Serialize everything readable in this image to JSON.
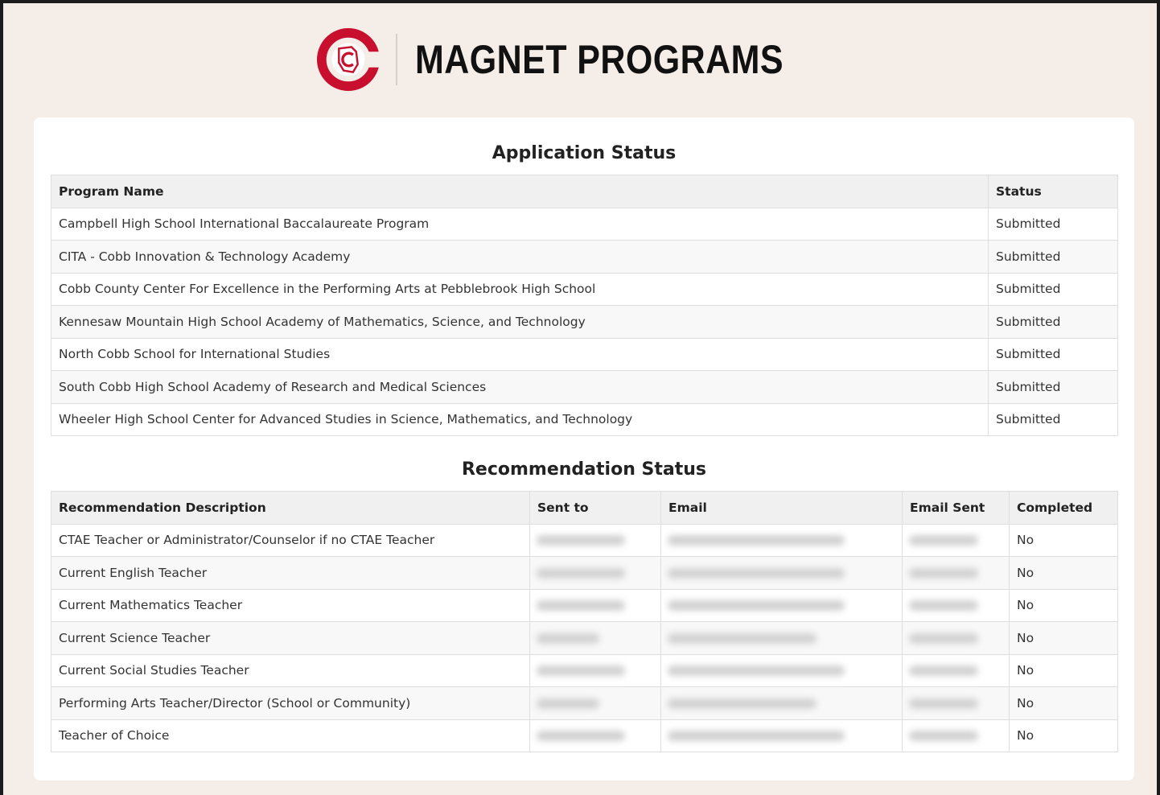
{
  "brand": {
    "title": "MAGNET PROGRAMS",
    "logo_icon": "cobb-county-c-logo-icon",
    "colors": {
      "logo_red": "#c8102e",
      "page_bg": "#f5eee8"
    }
  },
  "application": {
    "title": "Application Status",
    "headers": {
      "program": "Program Name",
      "status": "Status"
    },
    "rows": [
      {
        "program": "Campbell High School International Baccalaureate Program",
        "status": "Submitted"
      },
      {
        "program": "CITA - Cobb Innovation & Technology Academy",
        "status": "Submitted"
      },
      {
        "program": "Cobb County Center For Excellence in the Performing Arts at Pebblebrook High School",
        "status": "Submitted"
      },
      {
        "program": "Kennesaw Mountain High School Academy of Mathematics, Science, and Technology",
        "status": "Submitted"
      },
      {
        "program": "North Cobb School for International Studies",
        "status": "Submitted"
      },
      {
        "program": "South Cobb High School Academy of Research and Medical Sciences",
        "status": "Submitted"
      },
      {
        "program": "Wheeler High School Center for Advanced Studies in Science, Mathematics, and Technology",
        "status": "Submitted"
      }
    ]
  },
  "recommendation": {
    "title": "Recommendation Status",
    "headers": {
      "description": "Recommendation Description",
      "sent_to": "Sent to",
      "email": "Email",
      "email_sent": "Email Sent",
      "completed": "Completed"
    },
    "rows": [
      {
        "description": "CTAE Teacher or Administrator/Counselor if no CTAE Teacher",
        "completed": "No"
      },
      {
        "description": "Current English Teacher",
        "completed": "No"
      },
      {
        "description": "Current Mathematics Teacher",
        "completed": "No"
      },
      {
        "description": "Current Science Teacher",
        "completed": "No"
      },
      {
        "description": "Current Social Studies Teacher",
        "completed": "No"
      },
      {
        "description": "Performing Arts Teacher/Director (School or Community)",
        "completed": "No"
      },
      {
        "description": "Teacher of Choice",
        "completed": "No"
      }
    ],
    "redacted_fields": [
      "sent_to",
      "email",
      "email_sent"
    ]
  }
}
